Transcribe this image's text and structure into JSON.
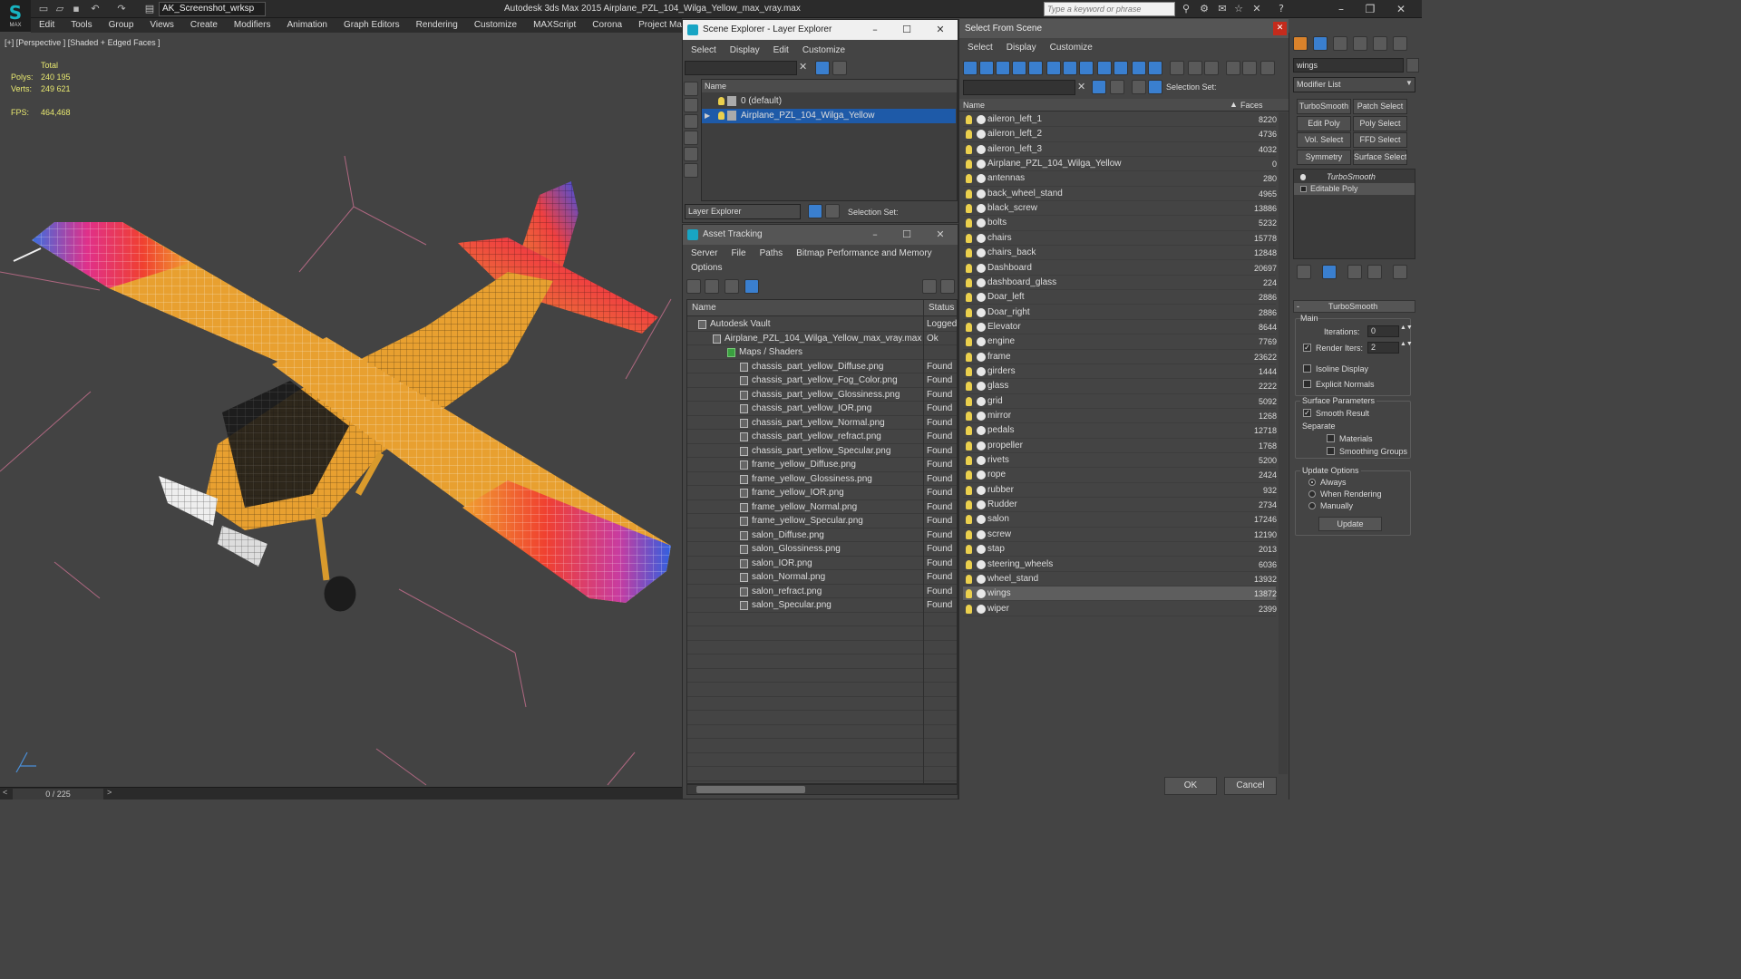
{
  "app": {
    "logo_text": "MAX",
    "workspace": "AK_Screenshot_wrksp",
    "title": "Autodesk 3ds Max  2015     Airplane_PZL_104_Wilga_Yellow_max_vray.max",
    "search_placeholder": "Type a keyword or phrase"
  },
  "menu": [
    "Edit",
    "Tools",
    "Group",
    "Views",
    "Create",
    "Modifiers",
    "Animation",
    "Graph Editors",
    "Rendering",
    "Customize",
    "MAXScript",
    "Corona",
    "Project Man"
  ],
  "viewport": {
    "label": "[+] [Perspective ] [Shaded + Edged Faces ]",
    "stats": {
      "total_label": "Total",
      "polys_label": "Polys:",
      "polys": "240 195",
      "verts_label": "Verts:",
      "verts": "249 621",
      "fps_label": "FPS:",
      "fps": "464,468"
    },
    "frame": "0 / 225"
  },
  "scene_explorer": {
    "title": "Scene Explorer - Layer Explorer",
    "menu": [
      "Select",
      "Display",
      "Edit",
      "Customize"
    ],
    "column": "Name",
    "rows": [
      "0 (default)",
      "Airplane_PZL_104_Wilga_Yellow"
    ],
    "footer_combo": "Layer Explorer",
    "selection_set_label": "Selection Set:"
  },
  "asset_tracking": {
    "title": "Asset Tracking",
    "menu": [
      "Server",
      "File",
      "Paths",
      "Bitmap Performance and Memory",
      "Options"
    ],
    "col_name": "Name",
    "col_status": "Status",
    "rows": [
      {
        "name": "Autodesk Vault",
        "status": "Logged",
        "level": 0
      },
      {
        "name": "Airplane_PZL_104_Wilga_Yellow_max_vray.max",
        "status": "Ok",
        "level": 1
      },
      {
        "name": "Maps / Shaders",
        "status": "",
        "level": 2
      },
      {
        "name": "chassis_part_yellow_Diffuse.png",
        "status": "Found",
        "level": 3
      },
      {
        "name": "chassis_part_yellow_Fog_Color.png",
        "status": "Found",
        "level": 3
      },
      {
        "name": "chassis_part_yellow_Glossiness.png",
        "status": "Found",
        "level": 3
      },
      {
        "name": "chassis_part_yellow_IOR.png",
        "status": "Found",
        "level": 3
      },
      {
        "name": "chassis_part_yellow_Normal.png",
        "status": "Found",
        "level": 3
      },
      {
        "name": "chassis_part_yellow_refract.png",
        "status": "Found",
        "level": 3
      },
      {
        "name": "chassis_part_yellow_Specular.png",
        "status": "Found",
        "level": 3
      },
      {
        "name": "frame_yellow_Diffuse.png",
        "status": "Found",
        "level": 3
      },
      {
        "name": "frame_yellow_Glossiness.png",
        "status": "Found",
        "level": 3
      },
      {
        "name": "frame_yellow_IOR.png",
        "status": "Found",
        "level": 3
      },
      {
        "name": "frame_yellow_Normal.png",
        "status": "Found",
        "level": 3
      },
      {
        "name": "frame_yellow_Specular.png",
        "status": "Found",
        "level": 3
      },
      {
        "name": "salon_Diffuse.png",
        "status": "Found",
        "level": 3
      },
      {
        "name": "salon_Glossiness.png",
        "status": "Found",
        "level": 3
      },
      {
        "name": "salon_IOR.png",
        "status": "Found",
        "level": 3
      },
      {
        "name": "salon_Normal.png",
        "status": "Found",
        "level": 3
      },
      {
        "name": "salon_refract.png",
        "status": "Found",
        "level": 3
      },
      {
        "name": "salon_Specular.png",
        "status": "Found",
        "level": 3
      }
    ]
  },
  "select_from_scene": {
    "title": "Select From Scene",
    "menu": [
      "Select",
      "Display",
      "Customize"
    ],
    "selection_set_label": "Selection Set:",
    "col_name": "Name",
    "col_faces": "Faces",
    "rows": [
      {
        "name": "aileron_left_1",
        "faces": "8220"
      },
      {
        "name": "aileron_left_2",
        "faces": "4736"
      },
      {
        "name": "aileron_left_3",
        "faces": "4032"
      },
      {
        "name": "Airplane_PZL_104_Wilga_Yellow",
        "faces": "0"
      },
      {
        "name": "antennas",
        "faces": "280"
      },
      {
        "name": "back_wheel_stand",
        "faces": "4965"
      },
      {
        "name": "black_screw",
        "faces": "13886"
      },
      {
        "name": "bolts",
        "faces": "5232"
      },
      {
        "name": "chairs",
        "faces": "15778"
      },
      {
        "name": "chairs_back",
        "faces": "12848"
      },
      {
        "name": "Dashboard",
        "faces": "20697"
      },
      {
        "name": "dashboard_glass",
        "faces": "224"
      },
      {
        "name": "Doar_left",
        "faces": "2886"
      },
      {
        "name": "Doar_right",
        "faces": "2886"
      },
      {
        "name": "Elevator",
        "faces": "8644"
      },
      {
        "name": "engine",
        "faces": "7769"
      },
      {
        "name": "frame",
        "faces": "23622"
      },
      {
        "name": "girders",
        "faces": "1444"
      },
      {
        "name": "glass",
        "faces": "2222"
      },
      {
        "name": "grid",
        "faces": "5092"
      },
      {
        "name": "mirror",
        "faces": "1268"
      },
      {
        "name": "pedals",
        "faces": "12718"
      },
      {
        "name": "propeller",
        "faces": "1768"
      },
      {
        "name": "rivets",
        "faces": "5200"
      },
      {
        "name": "rope",
        "faces": "2424"
      },
      {
        "name": "rubber",
        "faces": "932"
      },
      {
        "name": "Rudder",
        "faces": "2734"
      },
      {
        "name": "salon",
        "faces": "17246"
      },
      {
        "name": "screw",
        "faces": "12190"
      },
      {
        "name": "stap",
        "faces": "2013"
      },
      {
        "name": "steering_wheels",
        "faces": "6036"
      },
      {
        "name": "wheel_stand",
        "faces": "13932"
      },
      {
        "name": "wings",
        "faces": "13872"
      },
      {
        "name": "wiper",
        "faces": "2399"
      }
    ],
    "selected_index": 32,
    "ok": "OK",
    "cancel": "Cancel"
  },
  "command_panel": {
    "object_name": "wings",
    "modifier_list": "Modifier List",
    "mod_buttons": [
      "TurboSmooth",
      "Patch Select",
      "Edit Poly",
      "Poly Select",
      "Vol. Select",
      "FFD Select",
      "Symmetry",
      "Surface Select"
    ],
    "stack": [
      "TurboSmooth",
      "Editable Poly"
    ],
    "rollout_title": "TurboSmooth",
    "main_label": "Main",
    "iterations_label": "Iterations:",
    "iterations": "0",
    "render_iters_label": "Render Iters:",
    "render_iters": "2",
    "isoline": "Isoline Display",
    "explicit_normals": "Explicit Normals",
    "surface_params": "Surface Parameters",
    "smooth_result": "Smooth Result",
    "separate": "Separate",
    "materials": "Materials",
    "smoothing_groups": "Smoothing Groups",
    "update_options": "Update Options",
    "always": "Always",
    "when_rendering": "When Rendering",
    "manually": "Manually",
    "update": "Update"
  },
  "colors": {
    "selection_blue": "#1e5aa8",
    "bulb_yellow": "#ebd04d",
    "stat_yellow": "#e8e870",
    "plane_orange": "#e8a030",
    "max_teal": "#18b3c0"
  }
}
